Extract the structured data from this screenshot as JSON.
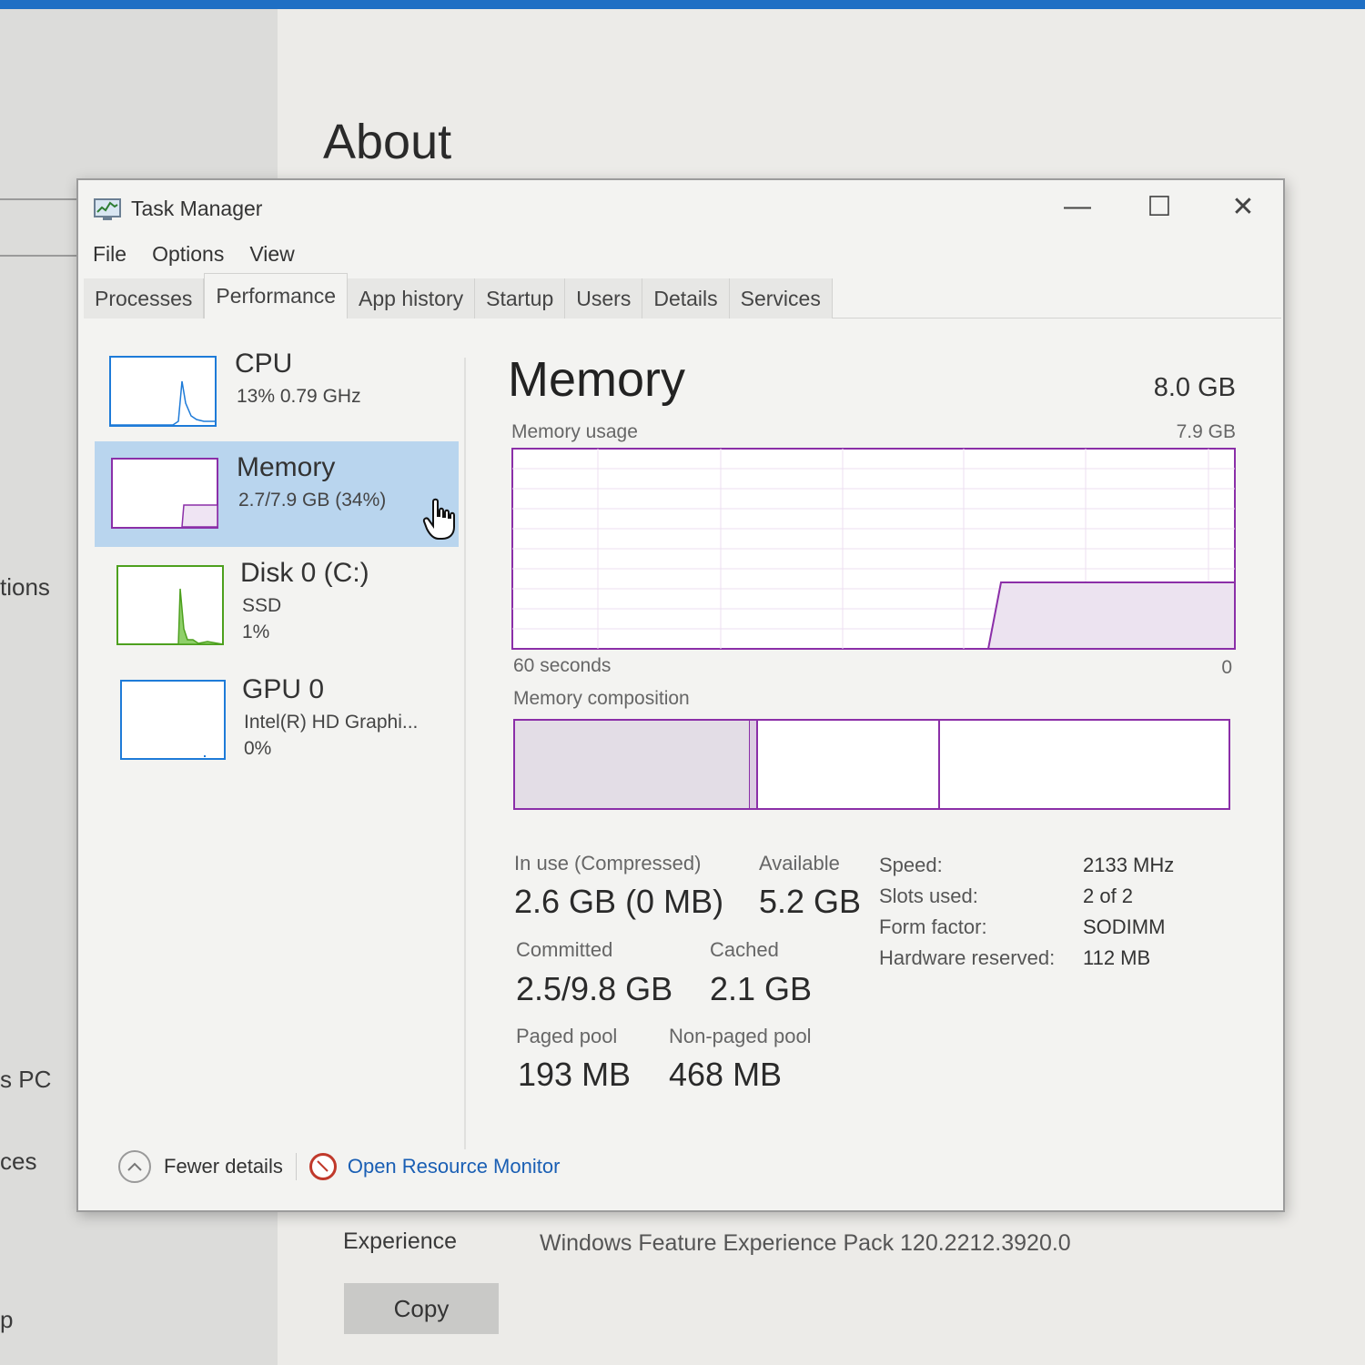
{
  "background": {
    "sidebar_fragments": [
      "tions",
      "s PC",
      "ces",
      "p"
    ],
    "about_title": "About",
    "experience_label": "Experience",
    "experience_value": "Windows Feature Experience Pack 120.2212.3920.0",
    "copy_label": "Copy"
  },
  "window": {
    "title": "Task Manager",
    "controls": {
      "minimize": "—",
      "maximize": "☐",
      "close": "✕"
    },
    "menu": [
      "File",
      "Options",
      "View"
    ],
    "tabs": [
      "Processes",
      "Performance",
      "App history",
      "Startup",
      "Users",
      "Details",
      "Services"
    ],
    "active_tab": "Performance"
  },
  "resources": [
    {
      "name": "CPU",
      "sub1": "13%  0.79 GHz",
      "sub2": "",
      "sub3": "",
      "color": "#1e7bd8"
    },
    {
      "name": "Memory",
      "sub1": "2.7/7.9 GB (34%)",
      "sub2": "",
      "sub3": "",
      "color": "#8b2fa8"
    },
    {
      "name": "Disk 0 (C:)",
      "sub1": "SSD",
      "sub2": "1%",
      "sub3": "",
      "color": "#4da01e"
    },
    {
      "name": "GPU 0",
      "sub1": "Intel(R) HD Graphi...",
      "sub2": "0%",
      "sub3": "",
      "color": "#1e7bd8"
    }
  ],
  "memory": {
    "title": "Memory",
    "total": "8.0 GB",
    "usage_label": "Memory usage",
    "usage_max": "7.9 GB",
    "x_left": "60 seconds",
    "x_right": "0",
    "composition_label": "Memory composition",
    "accent": "#8b2fa8",
    "stats": {
      "in_use_label": "In use (Compressed)",
      "in_use_value": "2.6 GB (0 MB)",
      "available_label": "Available",
      "available_value": "5.2 GB",
      "committed_label": "Committed",
      "committed_value": "2.5/9.8 GB",
      "cached_label": "Cached",
      "cached_value": "2.1 GB",
      "paged_label": "Paged pool",
      "paged_value": "193 MB",
      "nonpaged_label": "Non-paged pool",
      "nonpaged_value": "468 MB"
    },
    "specs": [
      {
        "label": "Speed:",
        "value": "2133 MHz"
      },
      {
        "label": "Slots used:",
        "value": "2 of 2"
      },
      {
        "label": "Form factor:",
        "value": "SODIMM"
      },
      {
        "label": "Hardware reserved:",
        "value": "112 MB"
      }
    ]
  },
  "footer": {
    "fewer_details": "Fewer details",
    "open_resource_monitor": "Open Resource Monitor"
  }
}
